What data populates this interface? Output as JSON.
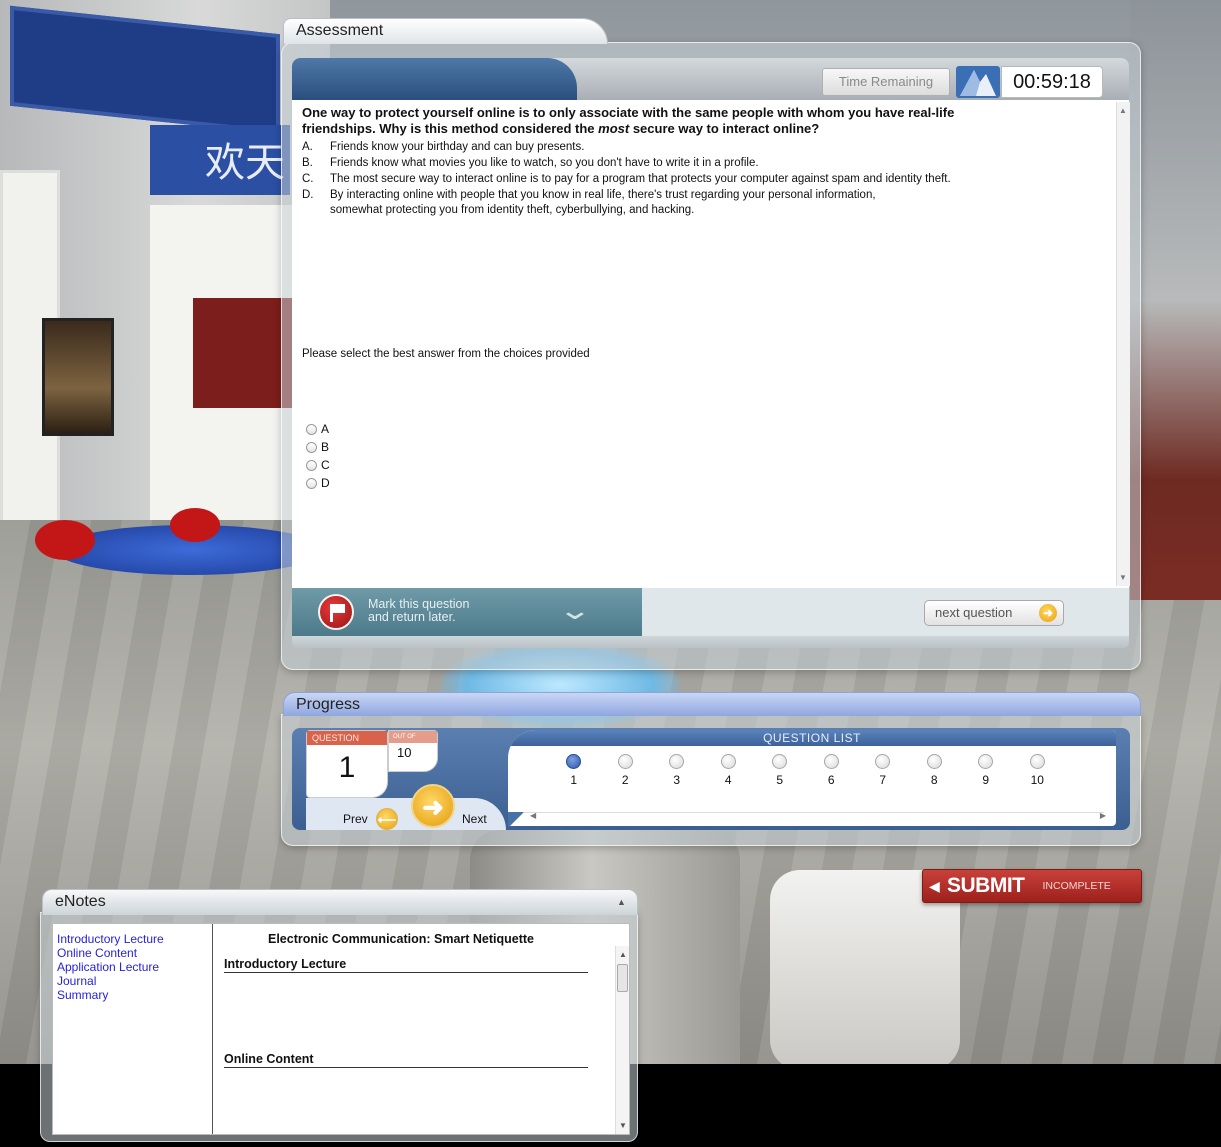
{
  "assessment": {
    "tab_title": "Assessment",
    "timer_label": "Time Remaining",
    "timer_value": "00:59:18",
    "question_lines": [
      "One way to protect yourself online is to only associate with the same people with whom you have real-life",
      "friendships. Why is this method considered the most secure way to interact online?"
    ],
    "choices": [
      {
        "letter": "A.",
        "text": "Friends know your birthday and can buy presents."
      },
      {
        "letter": "B.",
        "text": "Friends know what movies you like to watch, so you don't have to write it in a profile."
      },
      {
        "letter": "C.",
        "text": "The most secure way to interact online is to pay for a program that protects your computer against spam and identity theft."
      },
      {
        "letter": "D.",
        "text": "By interacting online with people that you know in real life, there's trust regarding your personal information, somewhat protecting you from identity theft, cyberbullying, and hacking."
      }
    ],
    "instruction": "Please select the best answer from the choices provided",
    "radio_options": [
      "A",
      "B",
      "C",
      "D"
    ],
    "mark_label_line1": "Mark this question",
    "mark_label_line2": "and return later.",
    "next_question_label": "next question"
  },
  "progress": {
    "tab_title": "Progress",
    "question_header": "QUESTION",
    "current_question": "1",
    "out_of_header": "OUT OF",
    "total_questions": "10",
    "prev_label": "Prev",
    "next_label": "Next",
    "question_list_header": "QUESTION LIST",
    "questions": [
      "1",
      "2",
      "3",
      "4",
      "5",
      "6",
      "7",
      "8",
      "9",
      "10"
    ],
    "current_index": 0
  },
  "submit": {
    "label": "SUBMIT",
    "status": "INCOMPLETE"
  },
  "enotes": {
    "tab_title": "eNotes",
    "nav": [
      "Introductory Lecture",
      "Online Content",
      "Application Lecture",
      "Journal",
      "Summary"
    ],
    "title": "Electronic Communication: Smart Netiquette",
    "sections": [
      "Introductory Lecture",
      "Online Content"
    ]
  },
  "scene": {
    "banner_text": "欢天"
  },
  "colors": {
    "submit_red": "#b1302b",
    "accent_blue": "#3b6fb5",
    "link_blue": "#2622d8",
    "button_orange": "#e8a10d"
  },
  "icons": {
    "flag": "flag-icon",
    "chevron": "chevron-down-icon",
    "next_arrow": "arrow-right-icon",
    "prev_arrow": "arrow-left-icon",
    "timer": "hourglass-icon"
  }
}
